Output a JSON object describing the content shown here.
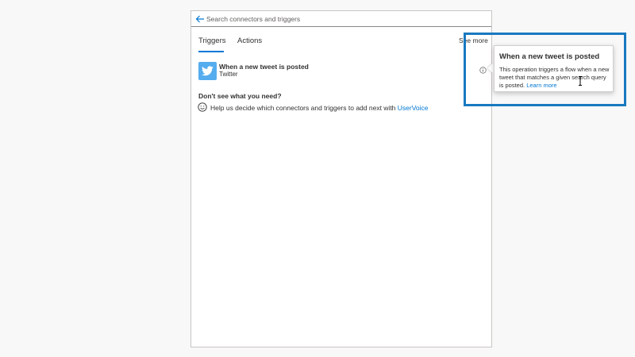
{
  "search": {
    "placeholder": "Search connectors and triggers"
  },
  "tabs": [
    {
      "label": "Triggers",
      "active": true
    },
    {
      "label": "Actions",
      "active": false
    }
  ],
  "see_more": "See more",
  "trigger": {
    "title": "When a new tweet is posted",
    "connector": "Twitter",
    "icon": "twitter-logo-icon"
  },
  "not_found": {
    "heading": "Don't see what you need?",
    "text": "Help us decide which connectors and triggers to add next with ",
    "link": "UserVoice"
  },
  "tooltip": {
    "title": "When a new tweet is posted",
    "body": "This operation triggers a flow when a new tweet that matches a given search query is posted. ",
    "link": "Learn more"
  },
  "colors": {
    "accent": "#0078d4",
    "twitter": "#55acee",
    "highlight": "#1979c0"
  }
}
